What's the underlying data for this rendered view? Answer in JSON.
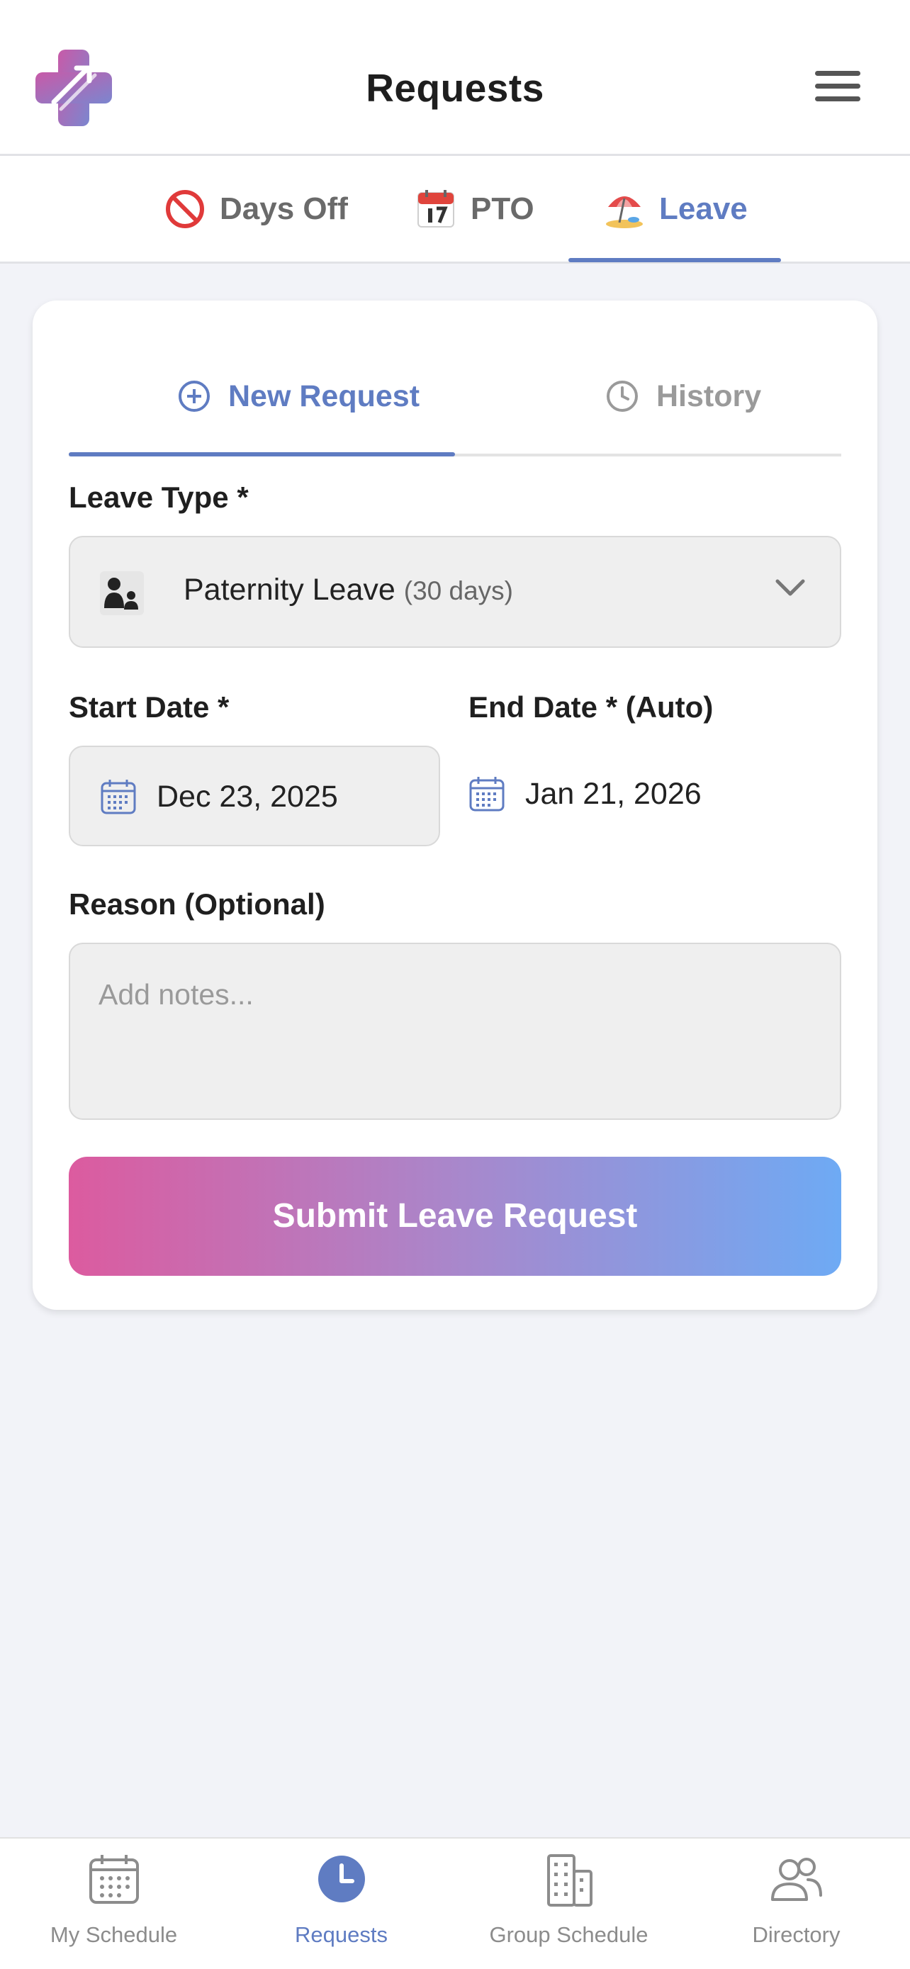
{
  "header": {
    "title": "Requests"
  },
  "category_tabs": [
    {
      "label": "Days Off",
      "icon": "no-entry-icon",
      "active": false
    },
    {
      "label": "PTO",
      "icon": "calendar-icon",
      "active": false
    },
    {
      "label": "Leave",
      "icon": "beach-umbrella-icon",
      "active": true
    }
  ],
  "sub_tabs": [
    {
      "label": "New Request",
      "icon": "plus-circle-icon",
      "active": true
    },
    {
      "label": "History",
      "icon": "clock-icon",
      "active": false
    }
  ],
  "form": {
    "leave_type_label": "Leave Type *",
    "leave_type_value": "Paternity Leave",
    "leave_type_days": "(30 days)",
    "start_date_label": "Start Date *",
    "start_date_value": "Dec 23, 2025",
    "end_date_label": "End Date * (Auto)",
    "end_date_value": "Jan 21, 2026",
    "reason_label": "Reason (Optional)",
    "reason_placeholder": "Add notes...",
    "submit_label": "Submit Leave Request"
  },
  "bottom_nav": [
    {
      "label": "My Schedule",
      "icon": "calendar-grid-icon",
      "active": false
    },
    {
      "label": "Requests",
      "icon": "clock-filled-icon",
      "active": true
    },
    {
      "label": "Group Schedule",
      "icon": "building-icon",
      "active": false
    },
    {
      "label": "Directory",
      "icon": "people-icon",
      "active": false
    }
  ],
  "colors": {
    "accent": "#5f7cc2",
    "gradient_start": "#dc5b9f",
    "gradient_end": "#6eaaf4",
    "background": "#f2f3f8"
  }
}
